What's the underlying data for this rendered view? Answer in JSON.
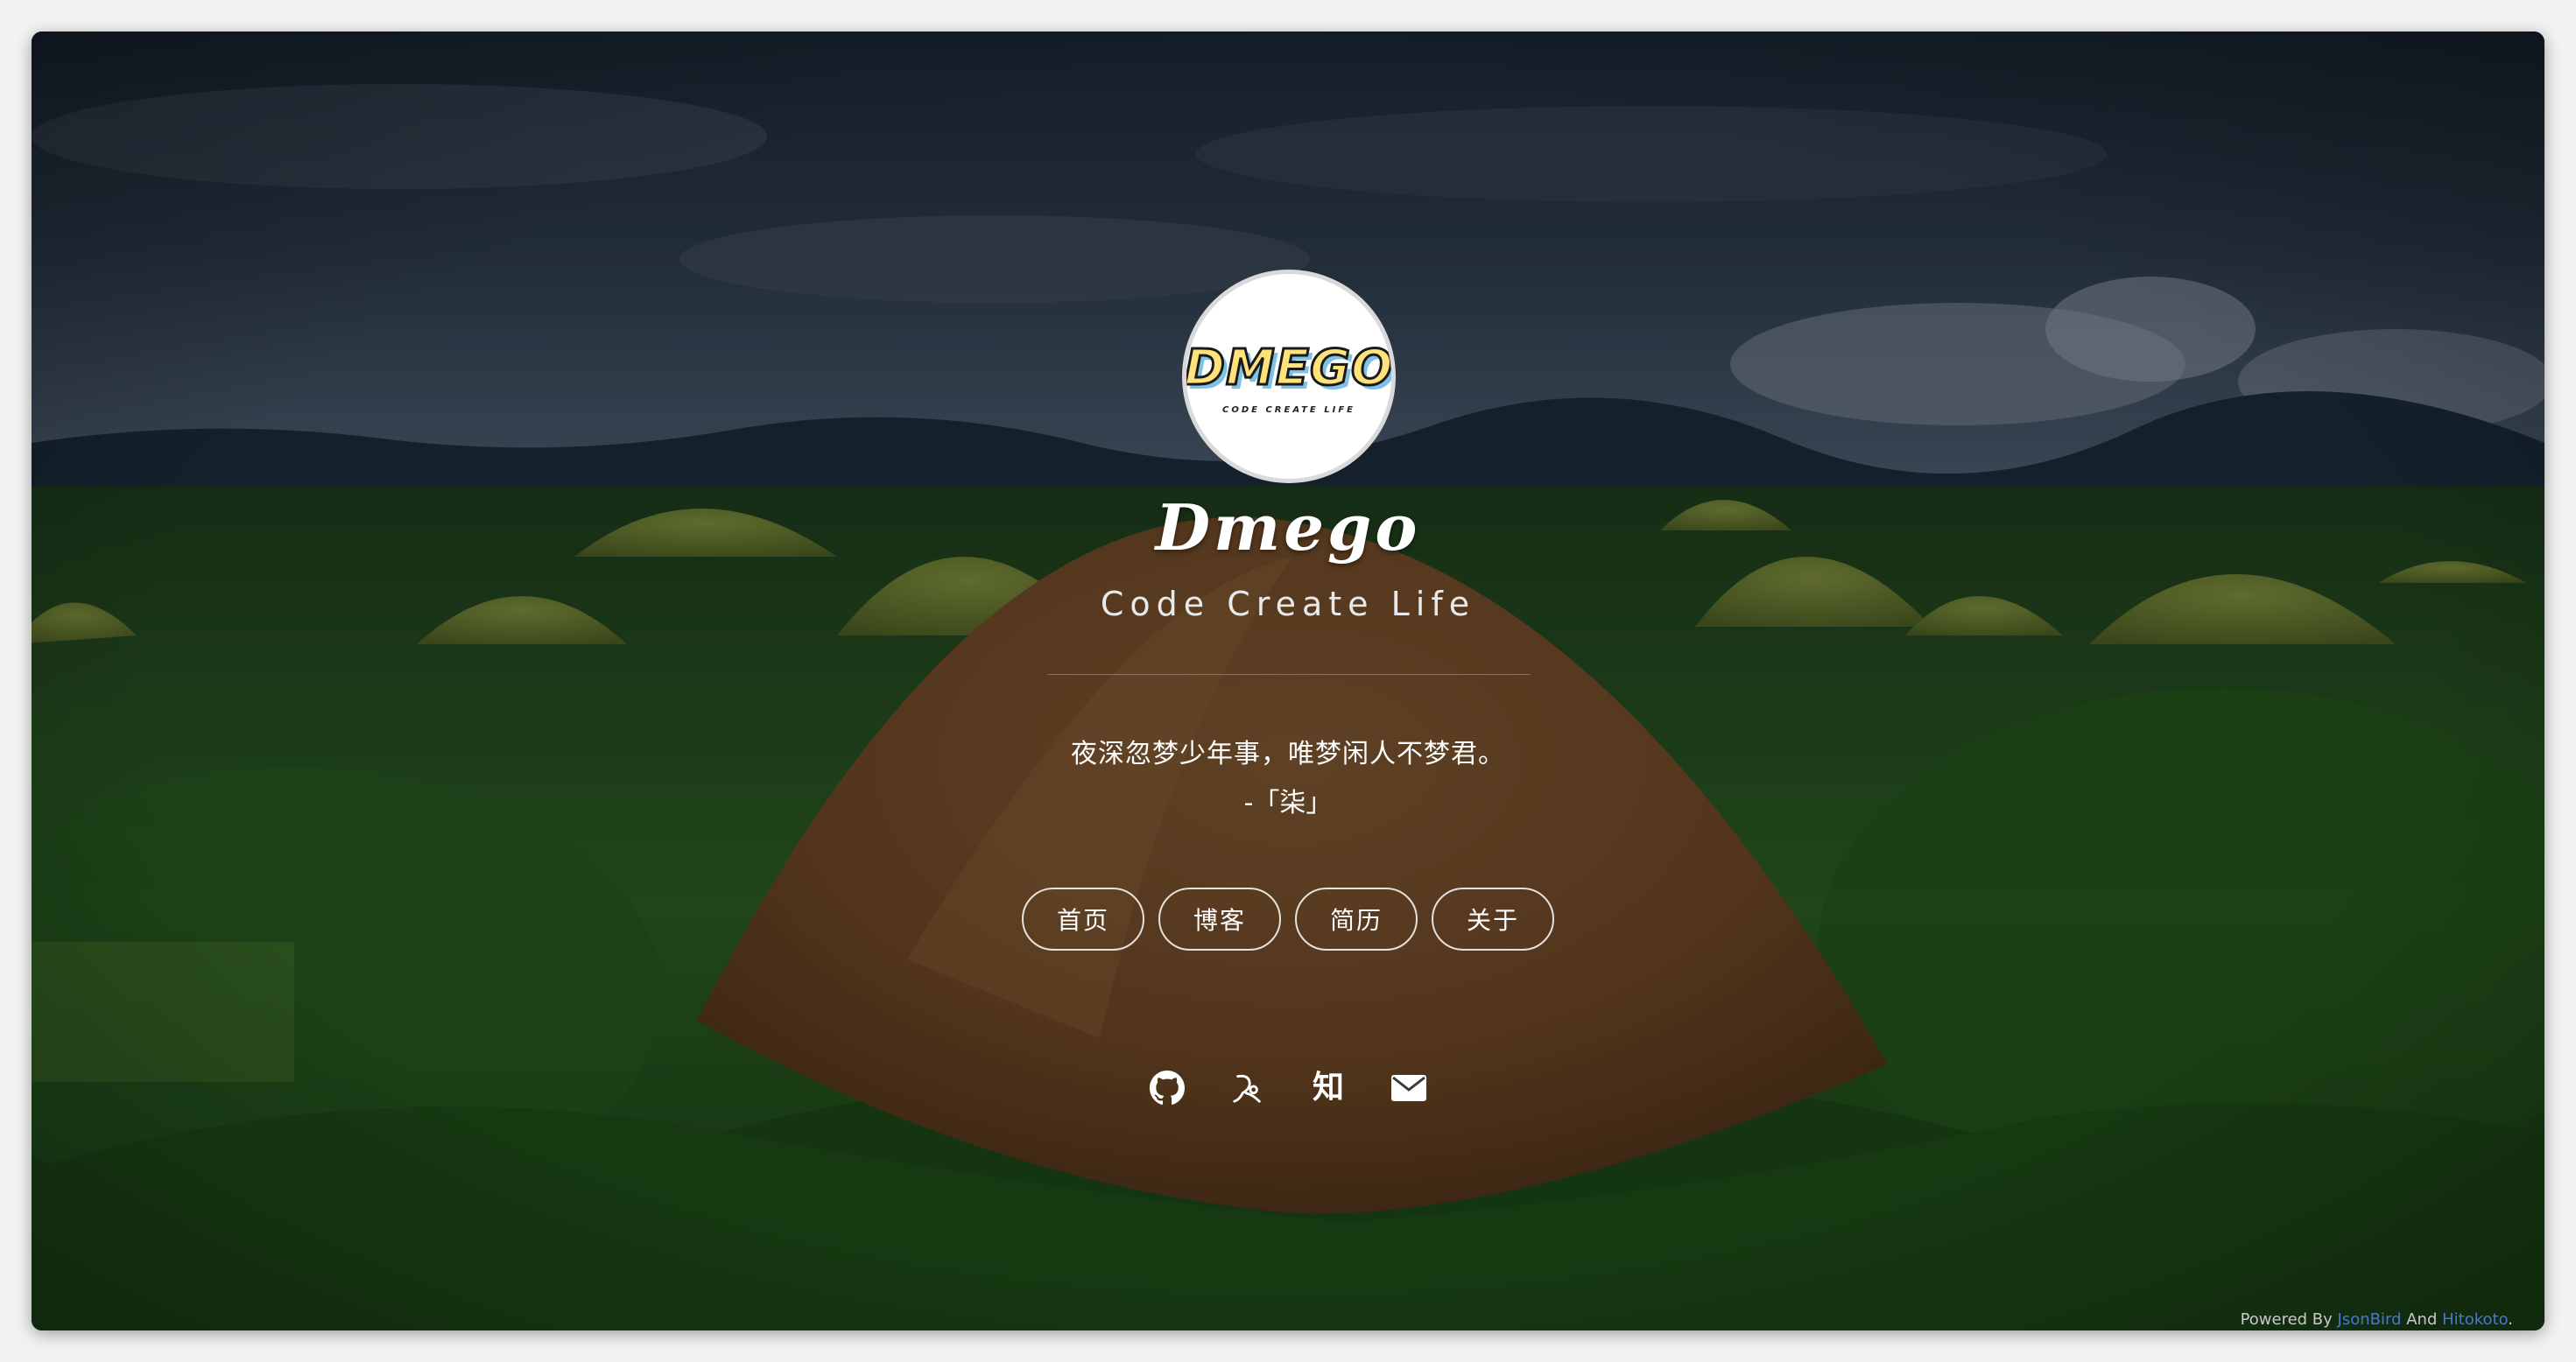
{
  "avatar": {
    "logo_text": "DMEGO",
    "logo_subtext": "CODE CREATE LIFE"
  },
  "site": {
    "name": "Dmego",
    "tagline": "Code Create Life"
  },
  "hitokoto": {
    "text": "夜深忽梦少年事，唯梦闲人不梦君。",
    "from": "-「柒」"
  },
  "nav": {
    "items": [
      {
        "label": "首页"
      },
      {
        "label": "博客"
      },
      {
        "label": "简历"
      },
      {
        "label": "关于"
      }
    ]
  },
  "social": {
    "icons": [
      "github-icon",
      "blog-icon",
      "zhihu-icon",
      "email-icon"
    ],
    "zhihu_glyph": "知"
  },
  "footer": {
    "prefix": "Powered By ",
    "link1": "JsonBird",
    "middle": " And ",
    "link2": "Hitokoto",
    "suffix": "."
  },
  "colors": {
    "footer_link": "#4a78c8",
    "logo_fill": "#ffe27a",
    "logo_shadow": "#7ec2e6"
  }
}
